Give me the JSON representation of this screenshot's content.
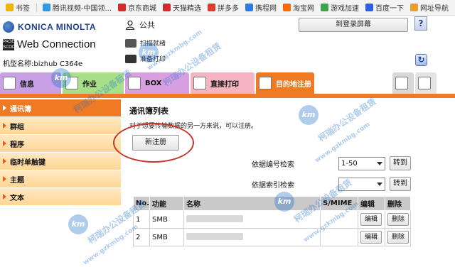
{
  "bookmarks": [
    {
      "label": "书签",
      "color": "#f1b600"
    },
    {
      "label": "腾讯视频-中国领...",
      "color": "#2e9be8"
    },
    {
      "label": "京东商城",
      "color": "#d62b2b"
    },
    {
      "label": "天猫精选",
      "color": "#d62b2b"
    },
    {
      "label": "拼多多",
      "color": "#e03a2e"
    },
    {
      "label": "携程网",
      "color": "#2e7be8"
    },
    {
      "label": "淘宝网",
      "color": "#ff6a00"
    },
    {
      "label": "游戏加速",
      "color": "#3aa84a"
    },
    {
      "label": "百度一下",
      "color": "#2e5fe8"
    },
    {
      "label": "网址导航",
      "color": "#e8a02e"
    }
  ],
  "header": {
    "brand": "KONICA MINOLTA",
    "pws_mark": "PAGE SCOPE",
    "pws": "Web Connection",
    "model": "机型名称:bizhub C364e",
    "user": "公共",
    "logout": "到登录屏幕",
    "help": "?",
    "status_scan": "扫描就绪",
    "status_print": "准备打印",
    "refresh": "↻"
  },
  "tabs": [
    {
      "label": "信息",
      "color": "#c8a0e6"
    },
    {
      "label": "作业",
      "color": "#a8e08a"
    },
    {
      "label": "BOX",
      "color": "#d8a0e0"
    },
    {
      "label": "直接打印",
      "color": "#f4b4c0"
    },
    {
      "label": "目的地注册",
      "color": "#f07a23"
    }
  ],
  "sidebar": {
    "items": [
      {
        "label": "通讯簿",
        "active": true
      },
      {
        "label": "群组",
        "active": false
      },
      {
        "label": "程序",
        "active": false
      },
      {
        "label": "临时单触键",
        "active": false
      },
      {
        "label": "主题",
        "active": false
      },
      {
        "label": "文本",
        "active": false
      }
    ]
  },
  "main": {
    "title": "通讯簿列表",
    "desc": "对于想要传输数据的另一方来说，可以注册。",
    "new_button": "新注册",
    "search_no": {
      "label": "依据编号检索",
      "value": "1-50",
      "go": "转到"
    },
    "search_idx": {
      "label": "依据索引检索",
      "value": "",
      "go": "转到"
    }
  },
  "table": {
    "headers": [
      "No.",
      "功能",
      "名称",
      "S/MIME",
      "编辑",
      "删除"
    ],
    "rows": [
      {
        "no": "1",
        "func": "SMB",
        "name": "",
        "smime": "",
        "edit": "编辑",
        "del": "删除"
      },
      {
        "no": "2",
        "func": "SMB",
        "name": "",
        "smime": "",
        "edit": "编辑",
        "del": "删除"
      }
    ]
  },
  "watermark": {
    "text": "柯瑞办公设备租赁",
    "url": "www.gzkmbg.com",
    "badge": "km"
  }
}
